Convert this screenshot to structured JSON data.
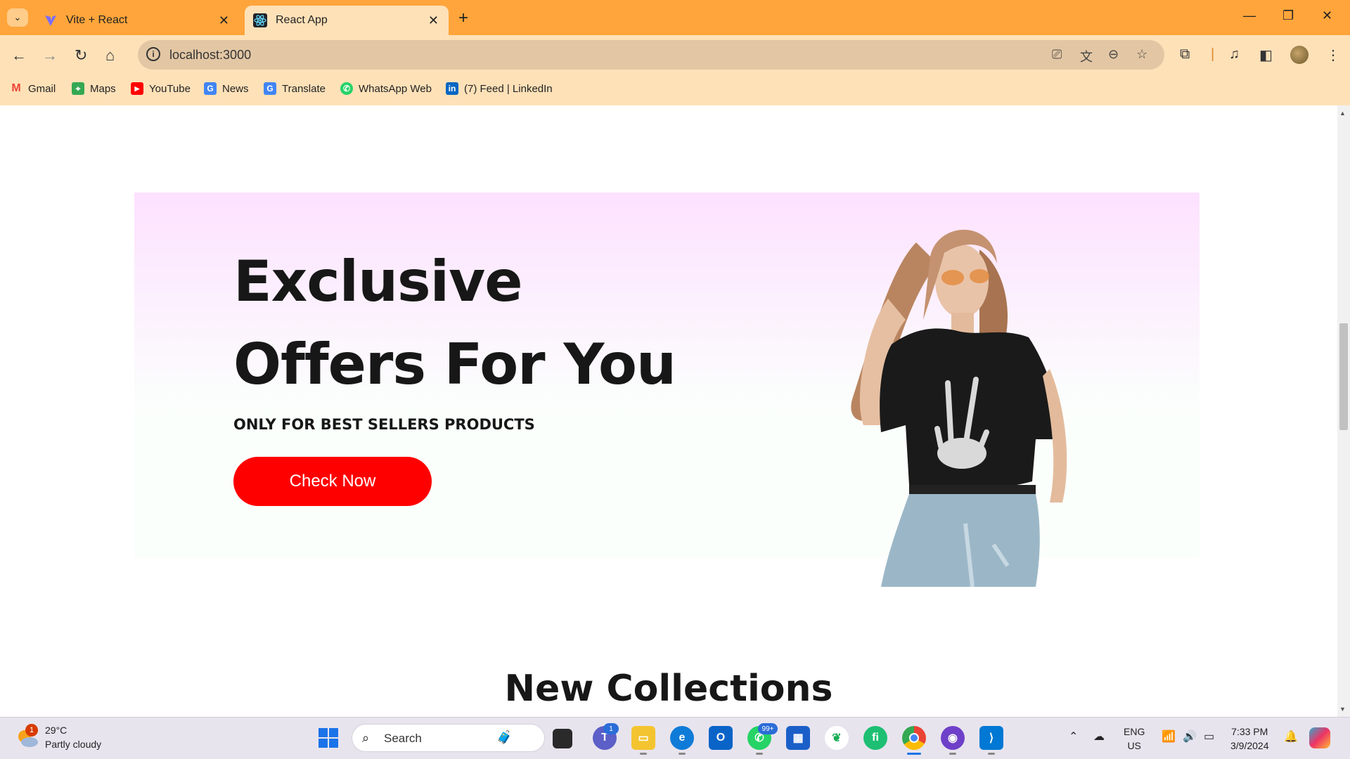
{
  "browser": {
    "tabs": [
      {
        "title": "Vite + React",
        "active": false
      },
      {
        "title": "React App",
        "active": true
      }
    ],
    "url": "localhost:3000",
    "bookmarks": [
      "Gmail",
      "Maps",
      "YouTube",
      "News",
      "Translate",
      "WhatsApp Web",
      "(7) Feed | LinkedIn"
    ]
  },
  "page": {
    "hero": {
      "title_line1": "Exclusive",
      "title_line2": "Offers For You",
      "subtitle": "ONLY FOR BEST SELLERS PRODUCTS",
      "button": "Check Now"
    },
    "section_title": "New Collections"
  },
  "taskbar": {
    "weather": {
      "temp": "29°C",
      "desc": "Partly cloudy",
      "badge": "1"
    },
    "search_placeholder": "Search",
    "teams_badge": "1",
    "whatsapp_badge": "99+",
    "lang_line1": "ENG",
    "lang_line2": "US",
    "time": "7:33 PM",
    "date": "3/9/2024"
  },
  "colors": {
    "tabbar": "#ffa53b",
    "toolbar": "#ffe1b8",
    "cta": "#ff0000",
    "hero_top": "#fde1ff"
  }
}
